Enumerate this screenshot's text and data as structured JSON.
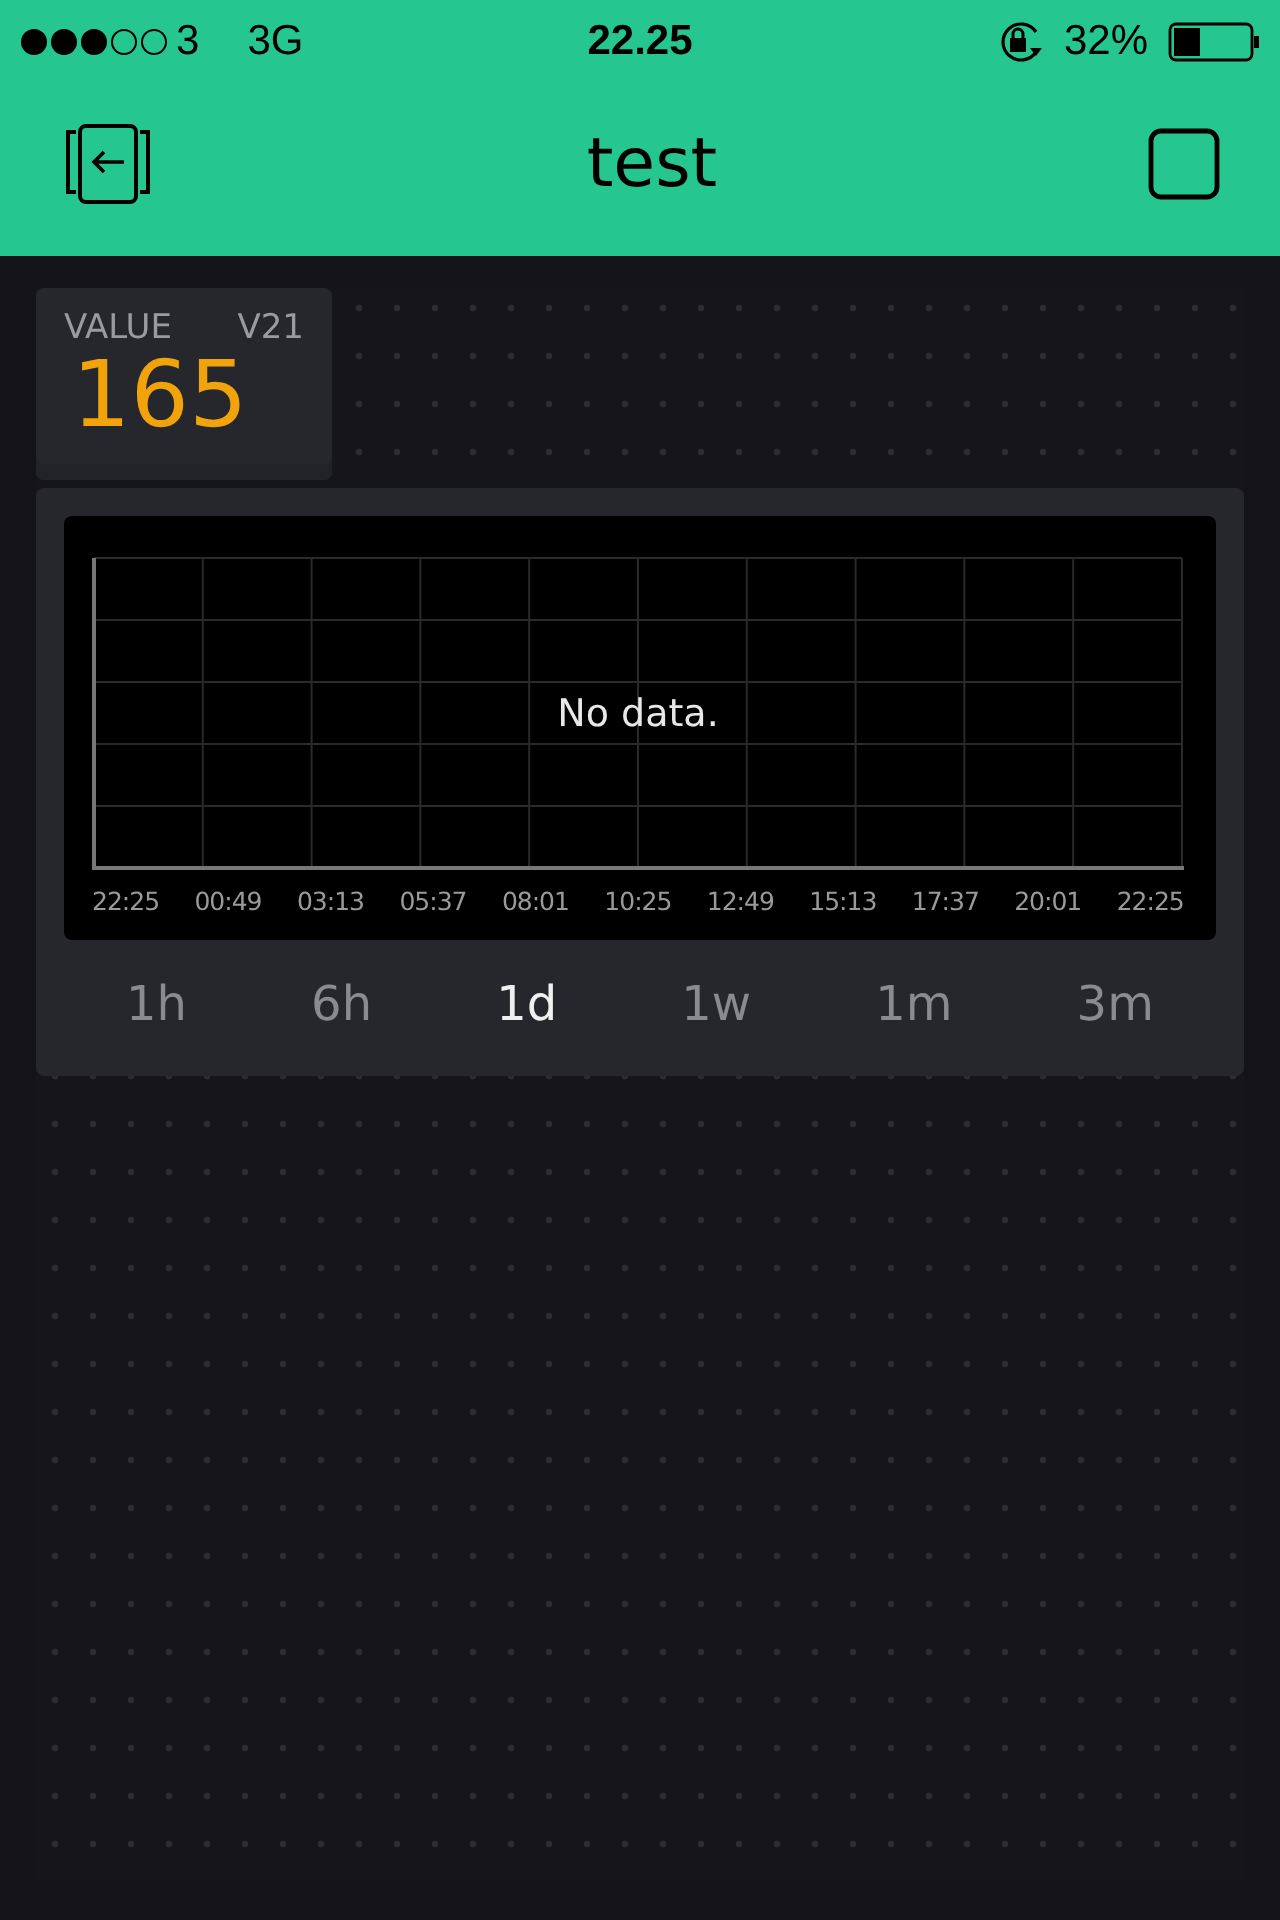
{
  "status_bar": {
    "carrier": "3",
    "network": "3G",
    "time": "22.25",
    "battery": "32%"
  },
  "header": {
    "title": "test"
  },
  "value_widget": {
    "label": "VALUE",
    "pin": "V21",
    "value": "165"
  },
  "chart_widget": {
    "message": "No data.",
    "x_labels": [
      "22:25",
      "00:49",
      "03:13",
      "05:37",
      "08:01",
      "10:25",
      "12:49",
      "15:13",
      "17:37",
      "20:01",
      "22:25"
    ],
    "ranges": [
      {
        "label": "1h",
        "selected": false
      },
      {
        "label": "6h",
        "selected": false
      },
      {
        "label": "1d",
        "selected": true
      },
      {
        "label": "1w",
        "selected": false
      },
      {
        "label": "1m",
        "selected": false
      },
      {
        "label": "3m",
        "selected": false
      }
    ]
  }
}
